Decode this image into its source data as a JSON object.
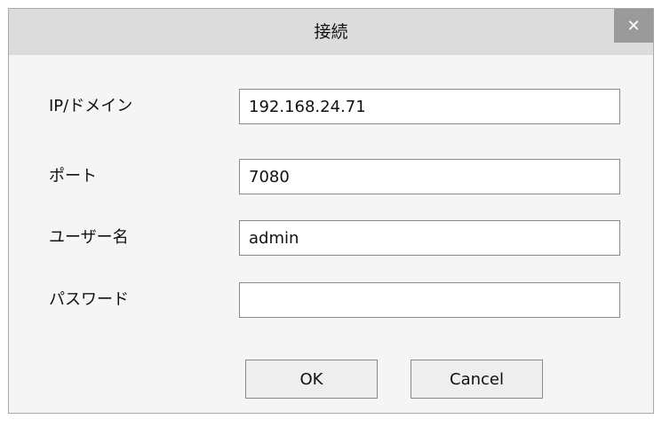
{
  "dialog": {
    "title": "接続",
    "close_icon": "close-icon",
    "close_glyph": "✕"
  },
  "form": {
    "host": {
      "label": "IP/ドメイン",
      "value": "192.168.24.71"
    },
    "port": {
      "label": "ポート",
      "value": "7080"
    },
    "username": {
      "label": "ユーザー名",
      "value": "admin"
    },
    "password": {
      "label": "パスワード",
      "value": ""
    }
  },
  "buttons": {
    "ok_label": "OK",
    "cancel_label": "Cancel"
  }
}
